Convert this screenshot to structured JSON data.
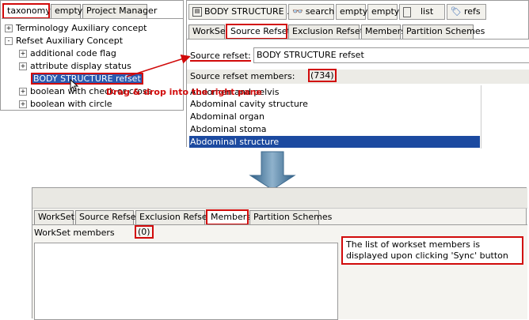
{
  "left_panel": {
    "tabs": [
      {
        "label": "taxonomy",
        "active": true
      },
      {
        "label": "empty",
        "active": false
      },
      {
        "label": "Project Manager",
        "active": false
      }
    ],
    "tree": [
      {
        "label": "Terminology Auxiliary concept",
        "expander": "+"
      },
      {
        "label": "Refset Auxiliary Concept",
        "expander": "-"
      },
      {
        "label": "additional code flag",
        "expander": "+"
      },
      {
        "label": "attribute display status",
        "expander": "+"
      },
      {
        "label": "BODY STRUCTURE refset",
        "expander": "",
        "selected": true
      },
      {
        "label": "boolean with check or cross",
        "expander": "+"
      },
      {
        "label": "boolean with circle",
        "expander": "+"
      }
    ]
  },
  "annotation": {
    "drag_text": "Drag & drop into the right pane"
  },
  "right_top": {
    "title_tabs": [
      {
        "label": "BODY STRUCTURE ...",
        "icon": "refset-icon"
      },
      {
        "label": "search",
        "icon": "binoculars-icon"
      },
      {
        "label": "empty",
        "icon": ""
      },
      {
        "label": "empty",
        "icon": ""
      },
      {
        "label": "list",
        "icon": "list-icon"
      },
      {
        "label": "refs",
        "icon": "refset-icon"
      }
    ],
    "subtabs": [
      {
        "label": "WorkSet",
        "active": false
      },
      {
        "label": "Source Refset",
        "active": true
      },
      {
        "label": "Exclusion Refsets",
        "active": false
      },
      {
        "label": "Members",
        "active": false
      },
      {
        "label": "Partition Schemes",
        "active": false
      }
    ],
    "source_refset_label": "Source refset:",
    "source_refset_value": "BODY STRUCTURE refset",
    "members_label": "Source refset members:",
    "members_count": "(734)",
    "members": [
      "Abdomen and pelvis",
      "Abdominal cavity structure",
      "Abdominal organ",
      "Abdominal stoma",
      "Abdominal structure"
    ],
    "selected_member_index": 4
  },
  "bottom": {
    "subtabs": [
      {
        "label": "WorkSet",
        "active": false
      },
      {
        "label": "Source Refset",
        "active": false
      },
      {
        "label": "Exclusion Refsets",
        "active": false
      },
      {
        "label": "Members",
        "active": true
      },
      {
        "label": "Partition Schemes",
        "active": false
      }
    ],
    "workset_label": "WorkSet members",
    "workset_count": "(0)",
    "note": "The list of workset members is displayed upon clicking 'Sync' button"
  },
  "colors": {
    "highlight_red": "#d10a0a",
    "selection_blue": "#1c4aa0",
    "arrow_fill": "#5d86a8"
  }
}
